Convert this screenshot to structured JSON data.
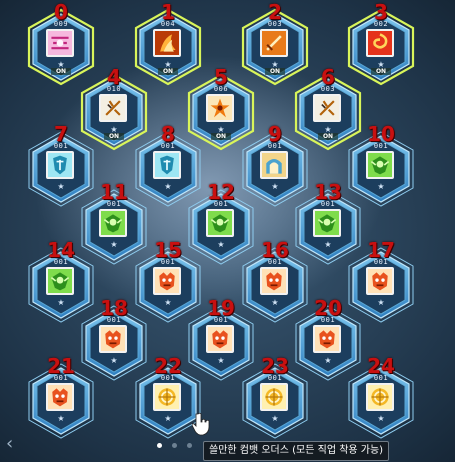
{
  "colors": {
    "hex_active_outline": "#d9f55a",
    "hex_blue_fill": "#2f7fc0",
    "hex_blue_inner": "#7fc7ef",
    "hex_dark_fill": "#1c3e5e",
    "slot_number": "#c81010"
  },
  "slots": [
    {
      "number": "0",
      "count": "009",
      "active": true,
      "on": "ON",
      "star": "★",
      "icon": "pink-glyph-icon"
    },
    {
      "number": "1",
      "count": "004",
      "active": true,
      "on": "ON",
      "star": "★",
      "icon": "orange-flame-icon"
    },
    {
      "number": "2",
      "count": "003",
      "active": true,
      "on": "ON",
      "star": "★",
      "icon": "sword-icon"
    },
    {
      "number": "3",
      "count": "002",
      "active": true,
      "on": "ON",
      "star": "★",
      "icon": "red-spiral-icon"
    },
    {
      "number": "4",
      "count": "010",
      "active": true,
      "on": "ON",
      "star": "★",
      "icon": "white-glyph-icon"
    },
    {
      "number": "5",
      "count": "006",
      "active": true,
      "on": "ON",
      "star": "★",
      "icon": "fire-burst-icon"
    },
    {
      "number": "6",
      "count": "003",
      "active": true,
      "on": "ON",
      "star": "★",
      "icon": "white-glyph-icon"
    },
    {
      "number": "7",
      "count": "001",
      "active": false,
      "on": "",
      "star": "★",
      "icon": "blue-crest-icon"
    },
    {
      "number": "8",
      "count": "001",
      "active": false,
      "on": "",
      "star": "★",
      "icon": "blue-crest-icon"
    },
    {
      "number": "9",
      "count": "001",
      "active": false,
      "on": "",
      "star": "★",
      "icon": "gate-icon"
    },
    {
      "number": "10",
      "count": "001",
      "active": false,
      "on": "",
      "star": "★",
      "icon": "green-crest-icon"
    },
    {
      "number": "11",
      "count": "001",
      "active": false,
      "on": "",
      "star": "★",
      "icon": "green-crest-icon"
    },
    {
      "number": "12",
      "count": "001",
      "active": false,
      "on": "",
      "star": "★",
      "icon": "green-crest-icon"
    },
    {
      "number": "13",
      "count": "001",
      "active": false,
      "on": "",
      "star": "★",
      "icon": "green-crest-icon"
    },
    {
      "number": "14",
      "count": "001",
      "active": false,
      "on": "",
      "star": "★",
      "icon": "green-crest-icon"
    },
    {
      "number": "15",
      "count": "001",
      "active": false,
      "on": "",
      "star": "★",
      "icon": "orange-mask-icon"
    },
    {
      "number": "16",
      "count": "001",
      "active": false,
      "on": "",
      "star": "★",
      "icon": "orange-mask-icon"
    },
    {
      "number": "17",
      "count": "001",
      "active": false,
      "on": "",
      "star": "★",
      "icon": "orange-mask-icon"
    },
    {
      "number": "18",
      "count": "001",
      "active": false,
      "on": "",
      "star": "★",
      "icon": "orange-mask-icon"
    },
    {
      "number": "19",
      "count": "001",
      "active": false,
      "on": "",
      "star": "★",
      "icon": "orange-mask-icon"
    },
    {
      "number": "20",
      "count": "001",
      "active": false,
      "on": "",
      "star": "★",
      "icon": "orange-mask-icon"
    },
    {
      "number": "21",
      "count": "001",
      "active": false,
      "on": "",
      "star": "★",
      "icon": "orange-mask-icon"
    },
    {
      "number": "22",
      "count": "001",
      "active": false,
      "on": "",
      "star": "★",
      "icon": "gold-emblem-icon"
    },
    {
      "number": "23",
      "count": "001",
      "active": false,
      "on": "",
      "star": "★",
      "icon": "gold-emblem-icon"
    },
    {
      "number": "24",
      "count": "001",
      "active": false,
      "on": "",
      "star": "★",
      "icon": "gold-emblem-icon"
    }
  ],
  "tooltip": {
    "text": "쓸만한 컴뱃 오더스 (모든 직업 착용 가능)"
  },
  "nav": {
    "prev_label": "‹"
  },
  "pager": {
    "active_page": 1,
    "page_count": 3
  }
}
